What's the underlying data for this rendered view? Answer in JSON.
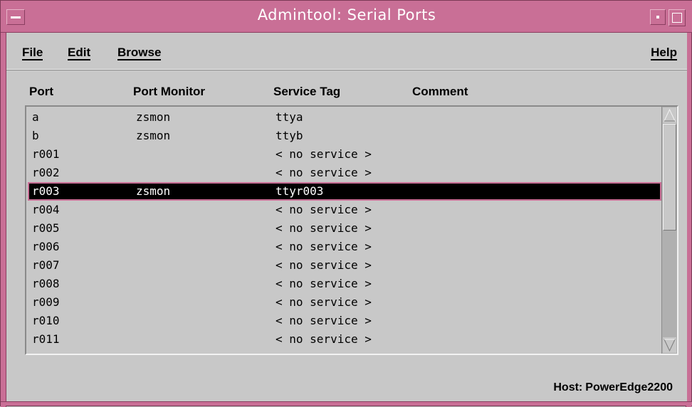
{
  "window": {
    "title": "Admintool: Serial Ports"
  },
  "menubar": {
    "file": "File",
    "edit": "Edit",
    "browse": "Browse",
    "help": "Help"
  },
  "columns": {
    "port": "Port",
    "port_monitor": "Port Monitor",
    "service_tag": "Service Tag",
    "comment": "Comment"
  },
  "rows": [
    {
      "port": "a",
      "monitor": "zsmon",
      "service": "ttya",
      "comment": ""
    },
    {
      "port": "b",
      "monitor": "zsmon",
      "service": "ttyb",
      "comment": ""
    },
    {
      "port": "r001",
      "monitor": "",
      "service": "< no service >",
      "comment": ""
    },
    {
      "port": "r002",
      "monitor": "",
      "service": "< no service >",
      "comment": ""
    },
    {
      "port": "r003",
      "monitor": "zsmon",
      "service": "ttyr003",
      "comment": "",
      "selected": true
    },
    {
      "port": "r004",
      "monitor": "",
      "service": "< no service >",
      "comment": ""
    },
    {
      "port": "r005",
      "monitor": "",
      "service": "< no service >",
      "comment": ""
    },
    {
      "port": "r006",
      "monitor": "",
      "service": "< no service >",
      "comment": ""
    },
    {
      "port": "r007",
      "monitor": "",
      "service": "< no service >",
      "comment": ""
    },
    {
      "port": "r008",
      "monitor": "",
      "service": "< no service >",
      "comment": ""
    },
    {
      "port": "r009",
      "monitor": "",
      "service": "< no service >",
      "comment": ""
    },
    {
      "port": "r010",
      "monitor": "",
      "service": "< no service >",
      "comment": ""
    },
    {
      "port": "r011",
      "monitor": "",
      "service": "< no service >",
      "comment": ""
    }
  ],
  "footer": {
    "host_label": "Host:",
    "host_value": "PowerEdge2200"
  },
  "colors": {
    "titlebar": "#c96f96",
    "selection": "#000000",
    "background": "#c8c8c8"
  },
  "icons": {
    "window_menu": "window-menu-icon",
    "minimize": "minimize-icon",
    "maximize": "maximize-icon",
    "scroll_up": "scroll-up-arrow-icon",
    "scroll_down": "scroll-down-arrow-icon"
  }
}
